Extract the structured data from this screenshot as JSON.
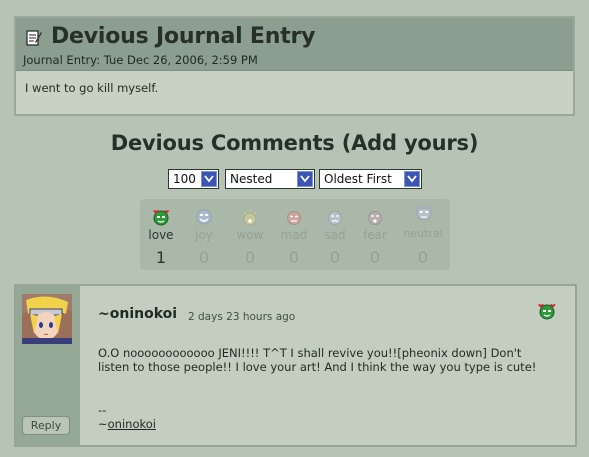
{
  "journal": {
    "title": "Devious Journal Entry",
    "date": "Journal Entry: Tue Dec 26, 2006, 2:59 PM",
    "body": "I went to go kill myself."
  },
  "comments_section": {
    "title": "Devious Comments (Add yours)",
    "selects": {
      "count": "100",
      "view": "Nested",
      "order": "Oldest First"
    }
  },
  "moods": [
    {
      "label": "love",
      "count": "1"
    },
    {
      "label": "joy",
      "count": "0"
    },
    {
      "label": "wow",
      "count": "0"
    },
    {
      "label": "mad",
      "count": "0"
    },
    {
      "label": "sad",
      "count": "0"
    },
    {
      "label": "fear",
      "count": "0"
    },
    {
      "label": "neutral",
      "count": "0"
    }
  ],
  "comment": {
    "username": "~oninokoi",
    "timestamp": "2 days 23 hours ago",
    "mood_icon": "love-icon",
    "text": "O.O noooooooooooo JENI!!!! T^T I shall revive you!![pheonix down] Don't listen to those people!! I love your art! And I think the way you type is cute!",
    "sig_dash": "--",
    "sig_prefix": "~",
    "sig_name": "oninokoi",
    "reply_label": "Reply"
  },
  "colors": {
    "background": "#b7c4b5",
    "header_band": "#8c9e8f",
    "select_button": "#3a55b3",
    "love_green": "#2f9a3a",
    "love_heart": "#d6263a"
  }
}
